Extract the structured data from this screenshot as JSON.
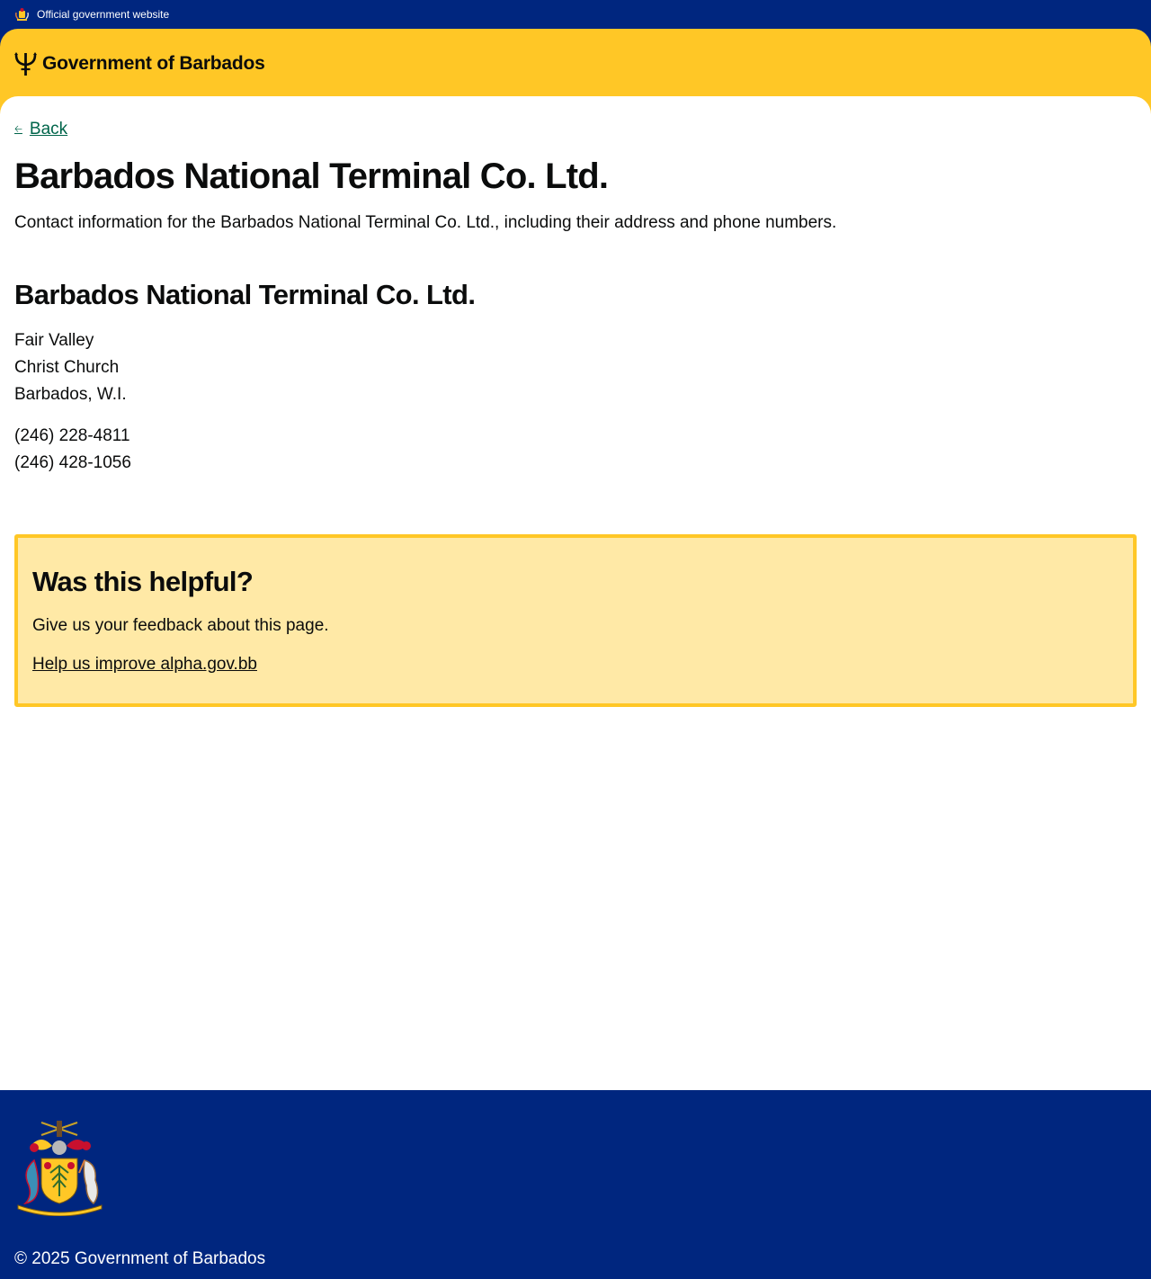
{
  "official_bar": {
    "text": "Official government website",
    "icon": "crest-icon"
  },
  "header": {
    "site_name": "Government of Barbados",
    "logo_icon": "trident-icon"
  },
  "navigation": {
    "back_label": "Back"
  },
  "page": {
    "title": "Barbados National Terminal Co. Ltd.",
    "summary": "Contact information for the Barbados National Terminal Co. Ltd., including their address and phone numbers."
  },
  "contact": {
    "organisation": "Barbados National Terminal Co. Ltd.",
    "address_lines": [
      "Fair Valley",
      "Christ Church",
      "Barbados, W.I."
    ],
    "phones": [
      "(246) 228-4811",
      "(246) 428-1056"
    ]
  },
  "feedback": {
    "title": "Was this helpful?",
    "text": "Give us your feedback about this page.",
    "link_label": "Help us improve alpha.gov.bb"
  },
  "footer": {
    "copyright": "© 2025 Government of Barbados",
    "logo_icon": "coat-of-arms-icon"
  },
  "colors": {
    "navy": "#00267f",
    "gold": "#ffc726",
    "feedback_bg": "#ffe9a6",
    "link_green": "#00654a"
  }
}
